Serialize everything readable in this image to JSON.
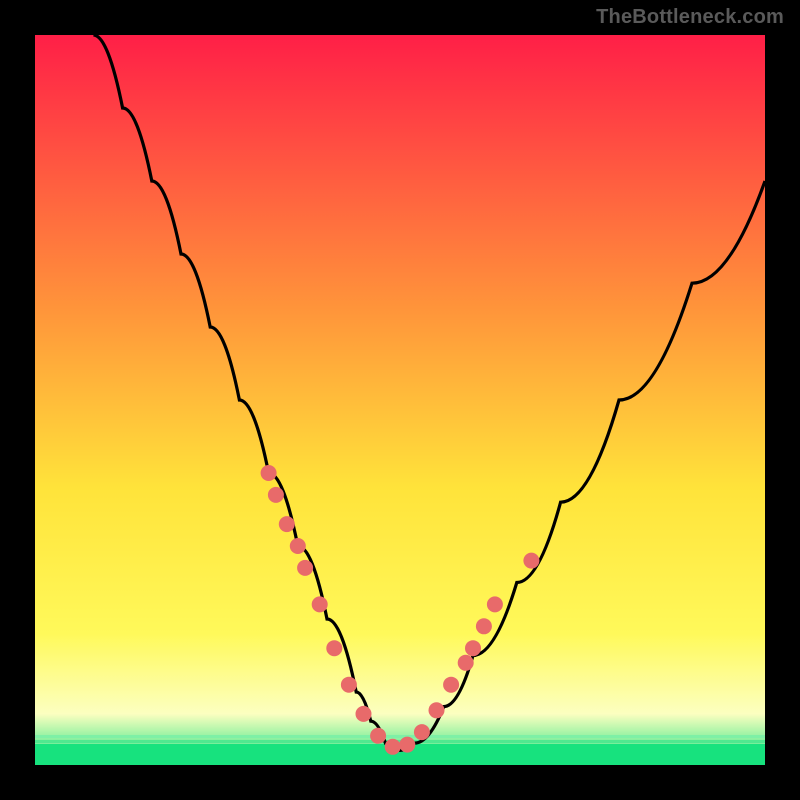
{
  "watermark": {
    "text": "TheBottleneck.com"
  },
  "colors": {
    "black": "#000000",
    "top": "#ff1f47",
    "mid_upper": "#ff7a3a",
    "mid": "#ffd23a",
    "mid_lower": "#fff05a",
    "pale": "#fdffb8",
    "green": "#17e27e",
    "curve": "#000000",
    "marker": "#e86a6a"
  },
  "chart_data": {
    "type": "line",
    "title": "",
    "xlabel": "",
    "ylabel": "",
    "xlim": [
      0,
      100
    ],
    "ylim": [
      0,
      100
    ],
    "grid": false,
    "series": [
      {
        "name": "bottleneck-curve",
        "x": [
          8,
          12,
          16,
          20,
          24,
          28,
          32,
          36,
          40,
          44,
          46,
          48,
          50,
          52,
          56,
          60,
          66,
          72,
          80,
          90,
          100
        ],
        "y": [
          100,
          90,
          80,
          70,
          60,
          50,
          40,
          30,
          20,
          10,
          6,
          3,
          2,
          3,
          8,
          15,
          25,
          36,
          50,
          66,
          80
        ]
      }
    ],
    "markers": {
      "name": "highlighted-points",
      "x": [
        32,
        33,
        34.5,
        36,
        37,
        39,
        41,
        43,
        45,
        47,
        49,
        51,
        53,
        55,
        57,
        59,
        60,
        61.5,
        63,
        68
      ],
      "y": [
        40,
        37,
        33,
        30,
        27,
        22,
        16,
        11,
        7,
        4,
        2.5,
        2.8,
        4.5,
        7.5,
        11,
        14,
        16,
        19,
        22,
        28
      ]
    },
    "bands": [
      {
        "name": "green-zone",
        "y0": 0,
        "y1": 3
      },
      {
        "name": "pale-zone",
        "y0": 3,
        "y1": 12
      },
      {
        "name": "yellow-zone",
        "y0": 12,
        "y1": 45
      },
      {
        "name": "orange-zone",
        "y0": 45,
        "y1": 75
      },
      {
        "name": "red-zone",
        "y0": 75,
        "y1": 100
      }
    ]
  }
}
